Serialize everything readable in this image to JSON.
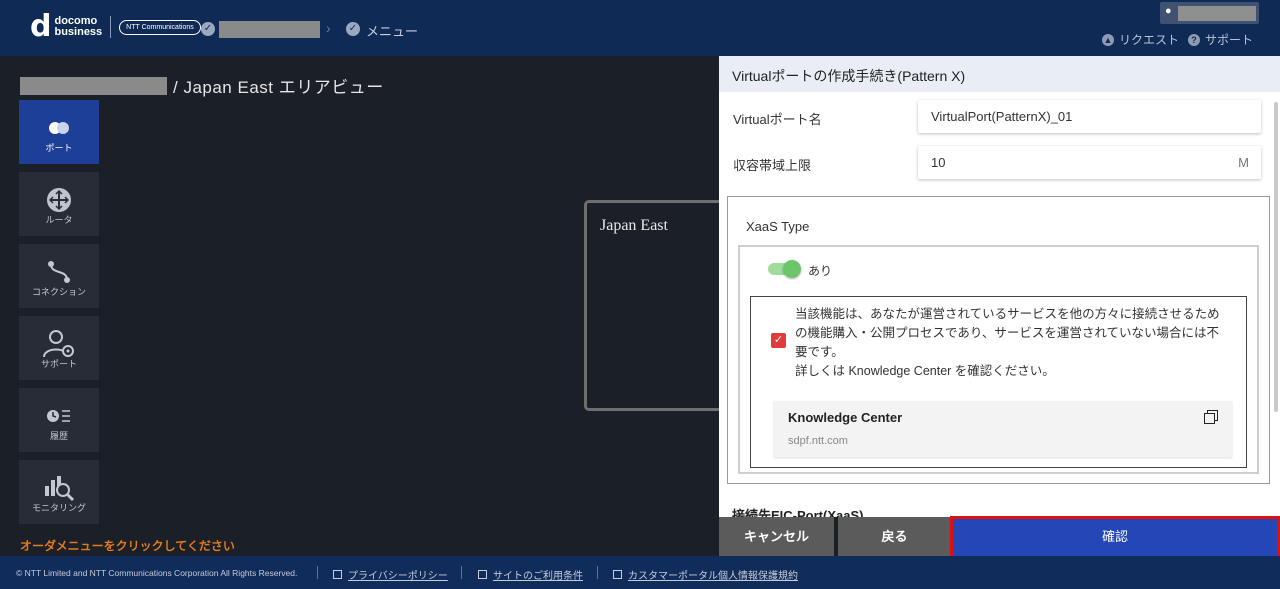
{
  "header": {
    "logo_main": "d",
    "logo_line1": "docomo",
    "logo_line2": "business",
    "ntt_logo": "NTT Communications",
    "breadcrumb_menu": "メニュー",
    "links": {
      "request": "リクエスト",
      "support": "サポート"
    }
  },
  "area": {
    "title": "/ Japan East エリアビュー",
    "region_label": "Japan East",
    "order_hint": "オーダメニューをクリックしてください"
  },
  "side_menu": [
    {
      "label": "ポート",
      "icon": "port-icon",
      "active": true
    },
    {
      "label": "ルータ",
      "icon": "router-icon",
      "active": false
    },
    {
      "label": "コネクション",
      "icon": "connection-icon",
      "active": false
    },
    {
      "label": "サポート",
      "icon": "support-icon",
      "active": false
    },
    {
      "label": "履歴",
      "icon": "history-icon",
      "active": false
    },
    {
      "label": "モニタリング",
      "icon": "monitoring-icon",
      "active": false
    }
  ],
  "panel": {
    "title": "Virtualポートの作成手続き(Pattern X)",
    "port_name_label": "Virtualポート名",
    "port_name_value": "VirtualPort(PatternX)_01",
    "bandwidth_label": "収容帯域上限",
    "bandwidth_value": "10",
    "bandwidth_unit": "M",
    "xaas_title": "XaaS Type",
    "toggle_label": "あり",
    "toggle_on": true,
    "notice_line1": "当該機能は、あなたが運営されているサービスを他の方々に接続させるため",
    "notice_line2": "の機能購入・公開プロセスであり、サービスを運営されていない場合には不",
    "notice_line3": "要です。",
    "notice_line4": "詳しくは Knowledge Center を確認ください。",
    "checkbox_checked": true,
    "kc_title": "Knowledge Center",
    "kc_url": "sdpf.ntt.com",
    "next_section_label": "接続先EIC-Port(XaaS)"
  },
  "buttons": {
    "cancel": "キャンセル",
    "back": "戻る",
    "confirm": "確認"
  },
  "footer": {
    "copyright": "© NTT Limited and NTT Communications Corporation All Rights Reserved.",
    "privacy": "プライバシーポリシー",
    "terms": "サイトのご利用条件",
    "customer_privacy": "カスタマーポータル個人情報保護規約"
  },
  "colors": {
    "header_bg": "#0e2a55",
    "active_menu": "#1e3f97",
    "confirm_button": "#2446b6",
    "highlight": "#e01010",
    "hint_text": "#e07a1c"
  }
}
